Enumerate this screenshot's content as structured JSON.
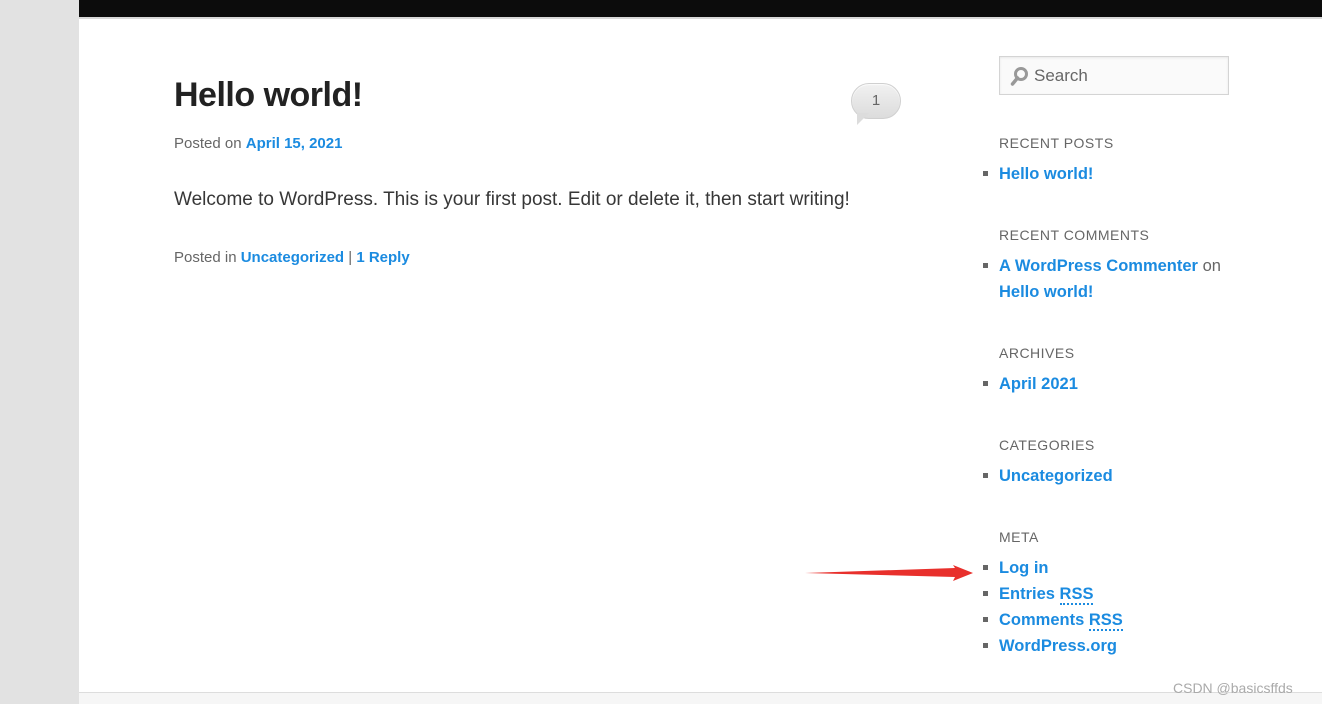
{
  "post": {
    "title": "Hello world!",
    "meta_prefix": "Posted on",
    "date": "April 15, 2021",
    "content": "Welcome to WordPress. This is your first post. Edit or delete it, then start writing!",
    "footer_prefix": "Posted in",
    "category": "Uncategorized",
    "separator": "|",
    "reply_link": "1 Reply",
    "comment_count": "1"
  },
  "sidebar": {
    "search_placeholder": "Search",
    "recent_posts": {
      "title": "RECENT POSTS",
      "items": [
        "Hello world!"
      ]
    },
    "recent_comments": {
      "title": "RECENT COMMENTS",
      "author": "A WordPress Commenter",
      "on": "on",
      "post": "Hello world!"
    },
    "archives": {
      "title": "ARCHIVES",
      "items": [
        "April 2021"
      ]
    },
    "categories": {
      "title": "CATEGORIES",
      "items": [
        "Uncategorized"
      ]
    },
    "meta": {
      "title": "META",
      "login": "Log in",
      "entries": "Entries",
      "comments": "Comments",
      "rss": "RSS",
      "wordpress_org": "WordPress.org"
    }
  },
  "watermark": "CSDN @basicsffds",
  "colors": {
    "link": "#1b8be0",
    "topbar": "#0c0c0c",
    "arrow": "#e8302c"
  },
  "icons": {
    "search": "search-icon",
    "annotation_arrow": "red-arrow-icon"
  }
}
